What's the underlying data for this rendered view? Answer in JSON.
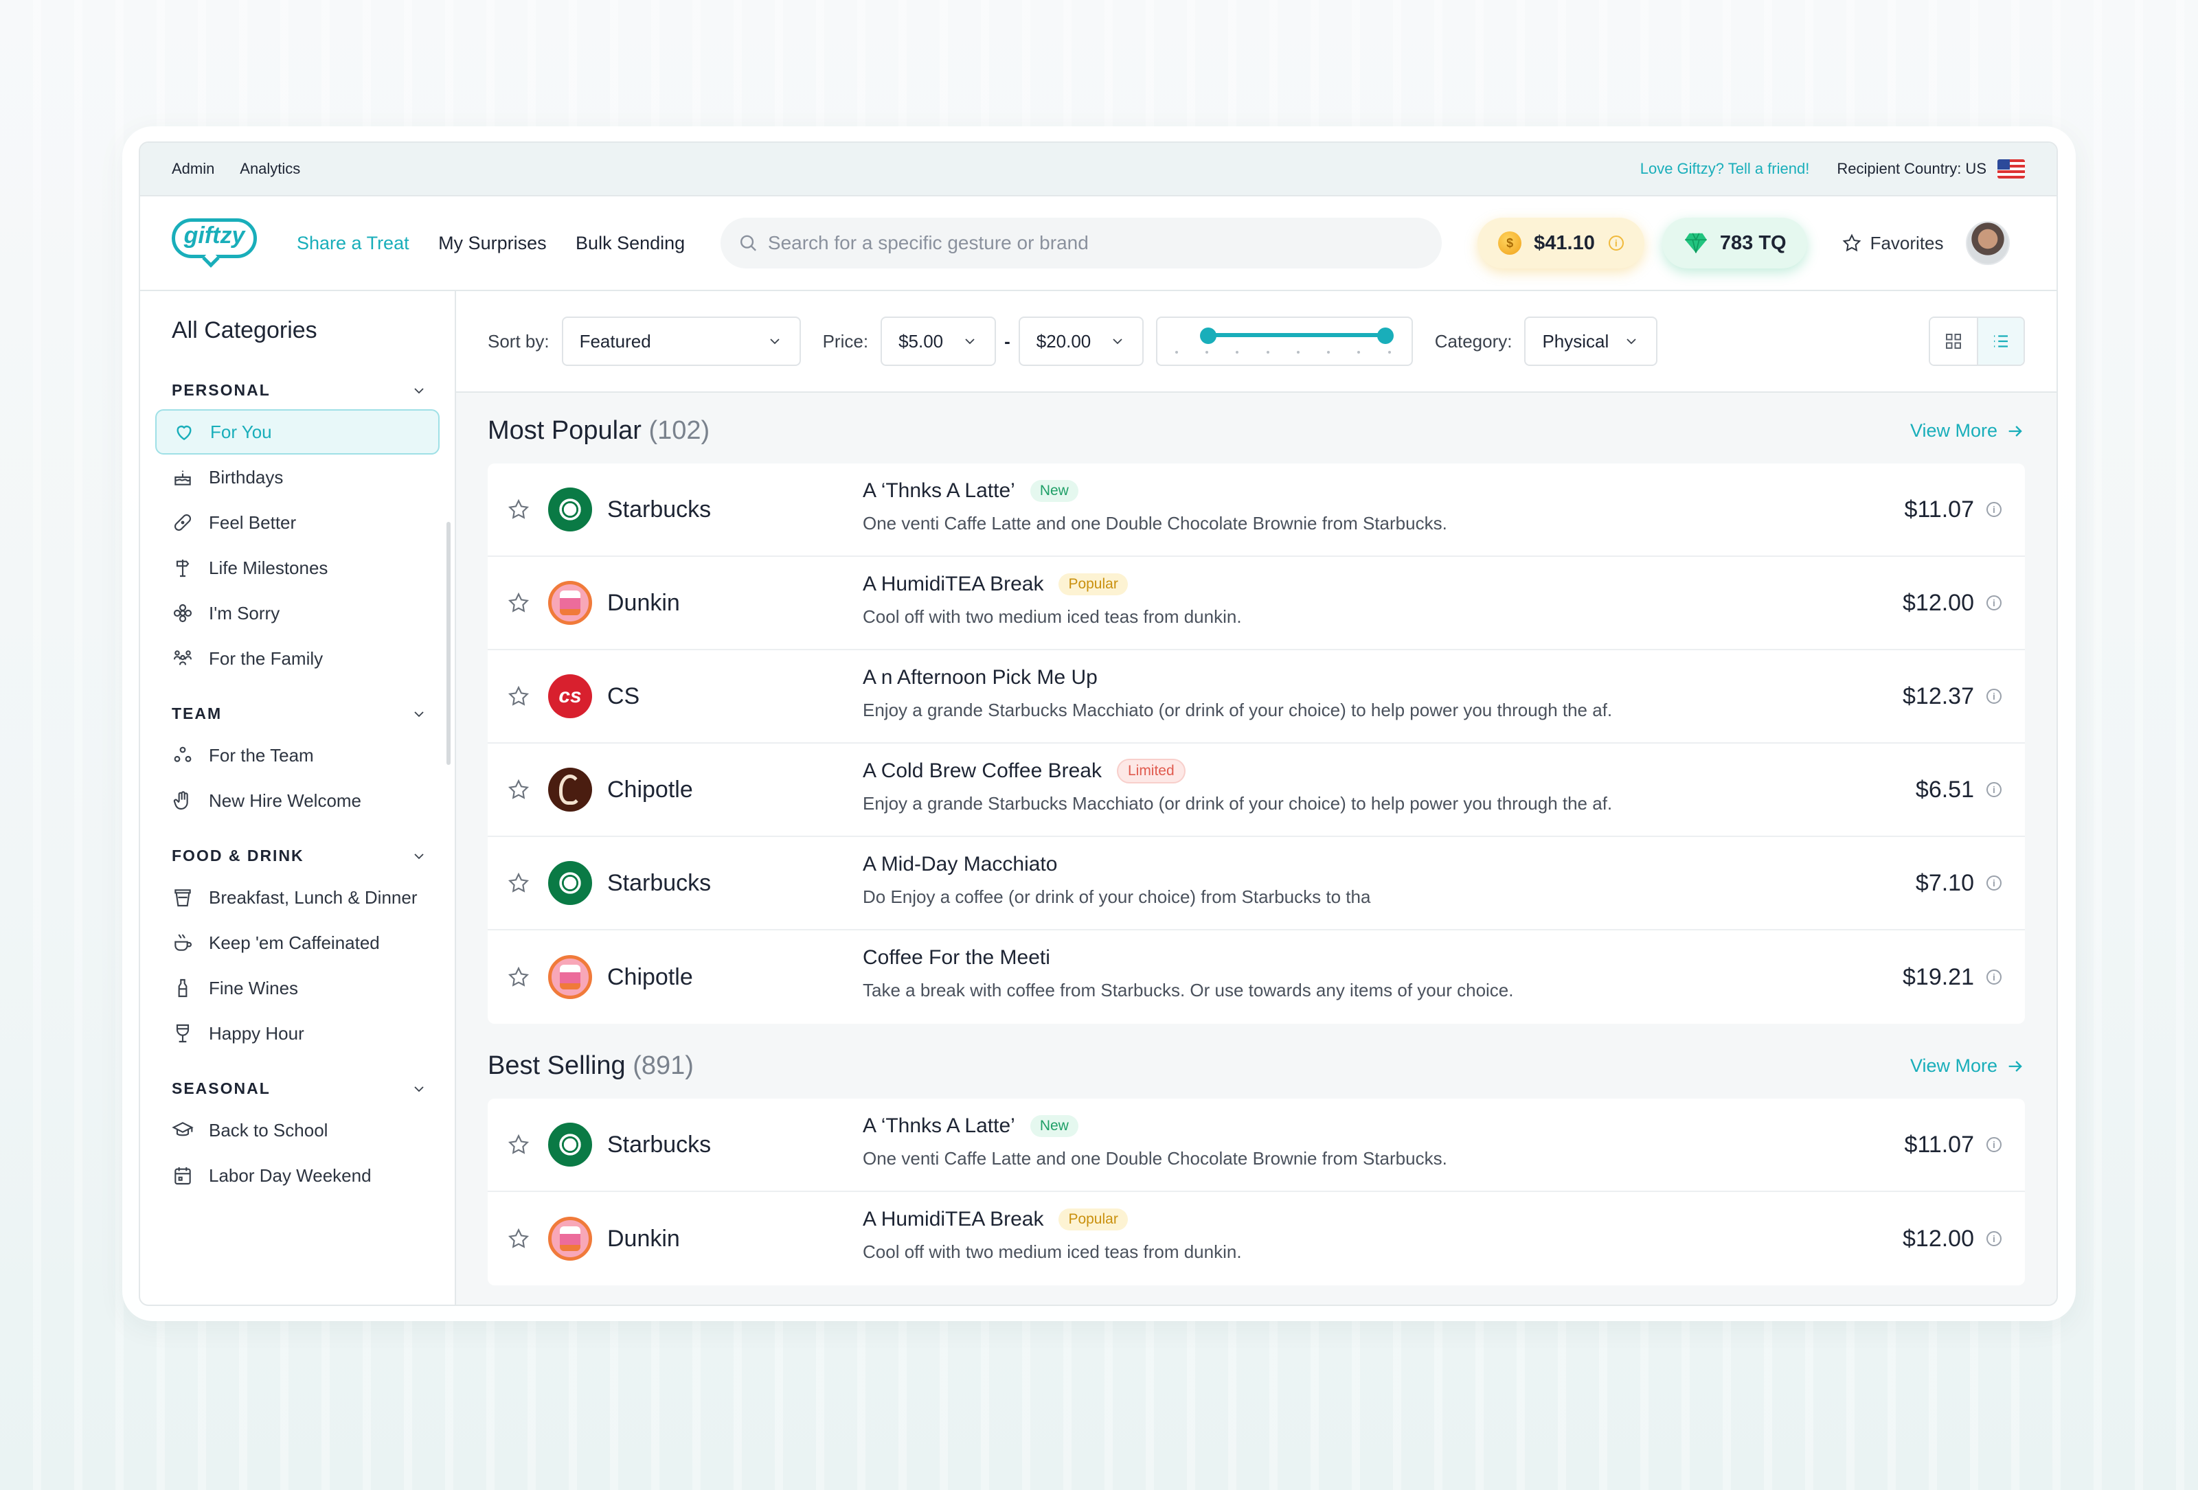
{
  "util": {
    "links": [
      "Admin",
      "Analytics"
    ],
    "promo": "Love Giftzy? Tell a friend!",
    "country_label": "Recipient Country: US"
  },
  "header": {
    "logo_text": "giftzy",
    "nav": [
      "Share a Treat",
      "My Surprises",
      "Bulk Sending"
    ],
    "search_placeholder": "Search for a specific gesture or brand",
    "balance": "$41.10",
    "tq": "783 TQ",
    "favorites": "Favorites"
  },
  "sidebar": {
    "title": "All Categories",
    "sections": [
      {
        "heading": "PERSONAL",
        "items": [
          "For You",
          "Birthdays",
          "Feel Better",
          "Life Milestones",
          "I'm Sorry",
          "For the Family"
        ]
      },
      {
        "heading": "TEAM",
        "items": [
          "For the Team",
          "New Hire Welcome"
        ]
      },
      {
        "heading": "FOOD & DRINK",
        "items": [
          "Breakfast, Lunch & Dinner",
          "Keep 'em Caffeinated",
          "Fine Wines",
          "Happy Hour"
        ]
      },
      {
        "heading": "SEASONAL",
        "items": [
          "Back to School",
          "Labor Day Weekend"
        ]
      }
    ]
  },
  "filters": {
    "sort_label": "Sort by:",
    "sort_value": "Featured",
    "price_label": "Price:",
    "price_min": "$5.00",
    "price_sep": "-",
    "price_max": "$20.00",
    "category_label": "Category:",
    "category_value": "Physical"
  },
  "sections": [
    {
      "title": "Most Popular",
      "count": "(102)",
      "view_more": "View More",
      "rows": [
        {
          "brand": "Starbucks",
          "title": "A ‘Thnks A Latte’",
          "badge": "New",
          "desc": "One venti Caffe Latte and one Double Chocolate Brownie from Starbucks.",
          "price": "$11.07"
        },
        {
          "brand": "Dunkin",
          "title": "A HumidiTEA Break",
          "badge": "Popular",
          "desc": "Cool off with two medium iced teas from dunkin.",
          "price": "$12.00"
        },
        {
          "brand": "CS",
          "title": "A n Afternoon Pick Me Up",
          "badge": "",
          "desc": " Enjoy a grande Starbucks Macchiato (or drink of your choice) to help power you through the af.",
          "price": "$12.37"
        },
        {
          "brand": "Chipotle",
          "title": "A  Cold Brew Coffee Break",
          "badge": "Limited",
          "desc": "Enjoy a grande Starbucks Macchiato (or drink of your choice) to help power you through the af.",
          "price": "$6.51"
        },
        {
          "brand": "Starbucks",
          "title": "A Mid-Day Macchiato",
          "badge": "",
          "desc": "Do Enjoy a coffee (or drink of your choice) from Starbucks to tha",
          "price": "$7.10"
        },
        {
          "brand": "Chipotle",
          "title": "Coffee For the Meeti",
          "badge": "",
          "desc": "Take a break with coffee from Starbucks. Or use towards any items of your choice.",
          "price": "$19.21"
        }
      ]
    },
    {
      "title": "Best Selling",
      "count": "(891)",
      "view_more": "View More",
      "rows": [
        {
          "brand": "Starbucks",
          "title": "A ‘Thnks A Latte’",
          "badge": "New",
          "desc": "One venti Caffe Latte and one Double Chocolate Brownie from Starbucks.",
          "price": "$11.07"
        },
        {
          "brand": "Dunkin",
          "title": "A HumidiTEA Break",
          "badge": "Popular",
          "desc": "Cool off with two medium iced teas from dunkin.",
          "price": "$12.00"
        }
      ]
    }
  ],
  "colors": {
    "accent": "#19aeba",
    "new": "#1f9f67",
    "popular": "#c9900e",
    "limited": "#e05a4e"
  }
}
